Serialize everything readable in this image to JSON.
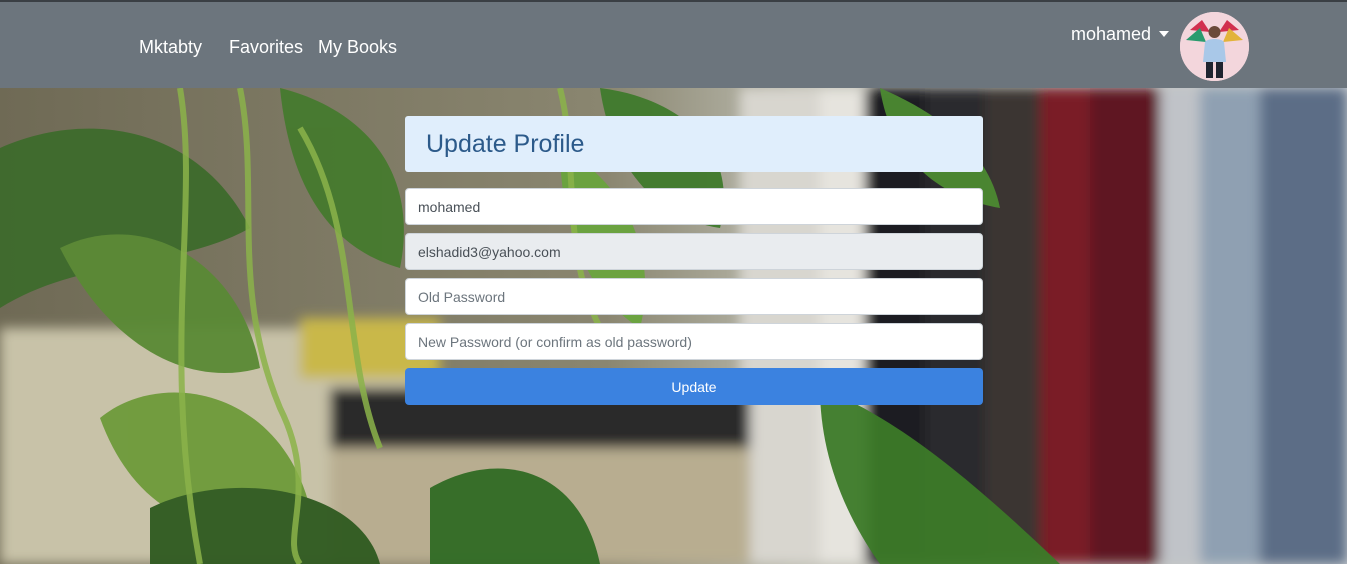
{
  "nav": {
    "brand": "Mktabty",
    "links": [
      "Favorites",
      "My Books"
    ],
    "user": "mohamed"
  },
  "form": {
    "title": "Update Profile",
    "username": "mohamed",
    "email": "elshadid3@yahoo.com",
    "old_password_placeholder": "Old Password",
    "new_password_placeholder": "New Password (or confirm as old password)",
    "submit_label": "Update"
  },
  "colors": {
    "navbar": "#6c757d",
    "title_bg": "#e0eefc",
    "title_text": "#2c5a8a",
    "button": "#3b82e0"
  }
}
